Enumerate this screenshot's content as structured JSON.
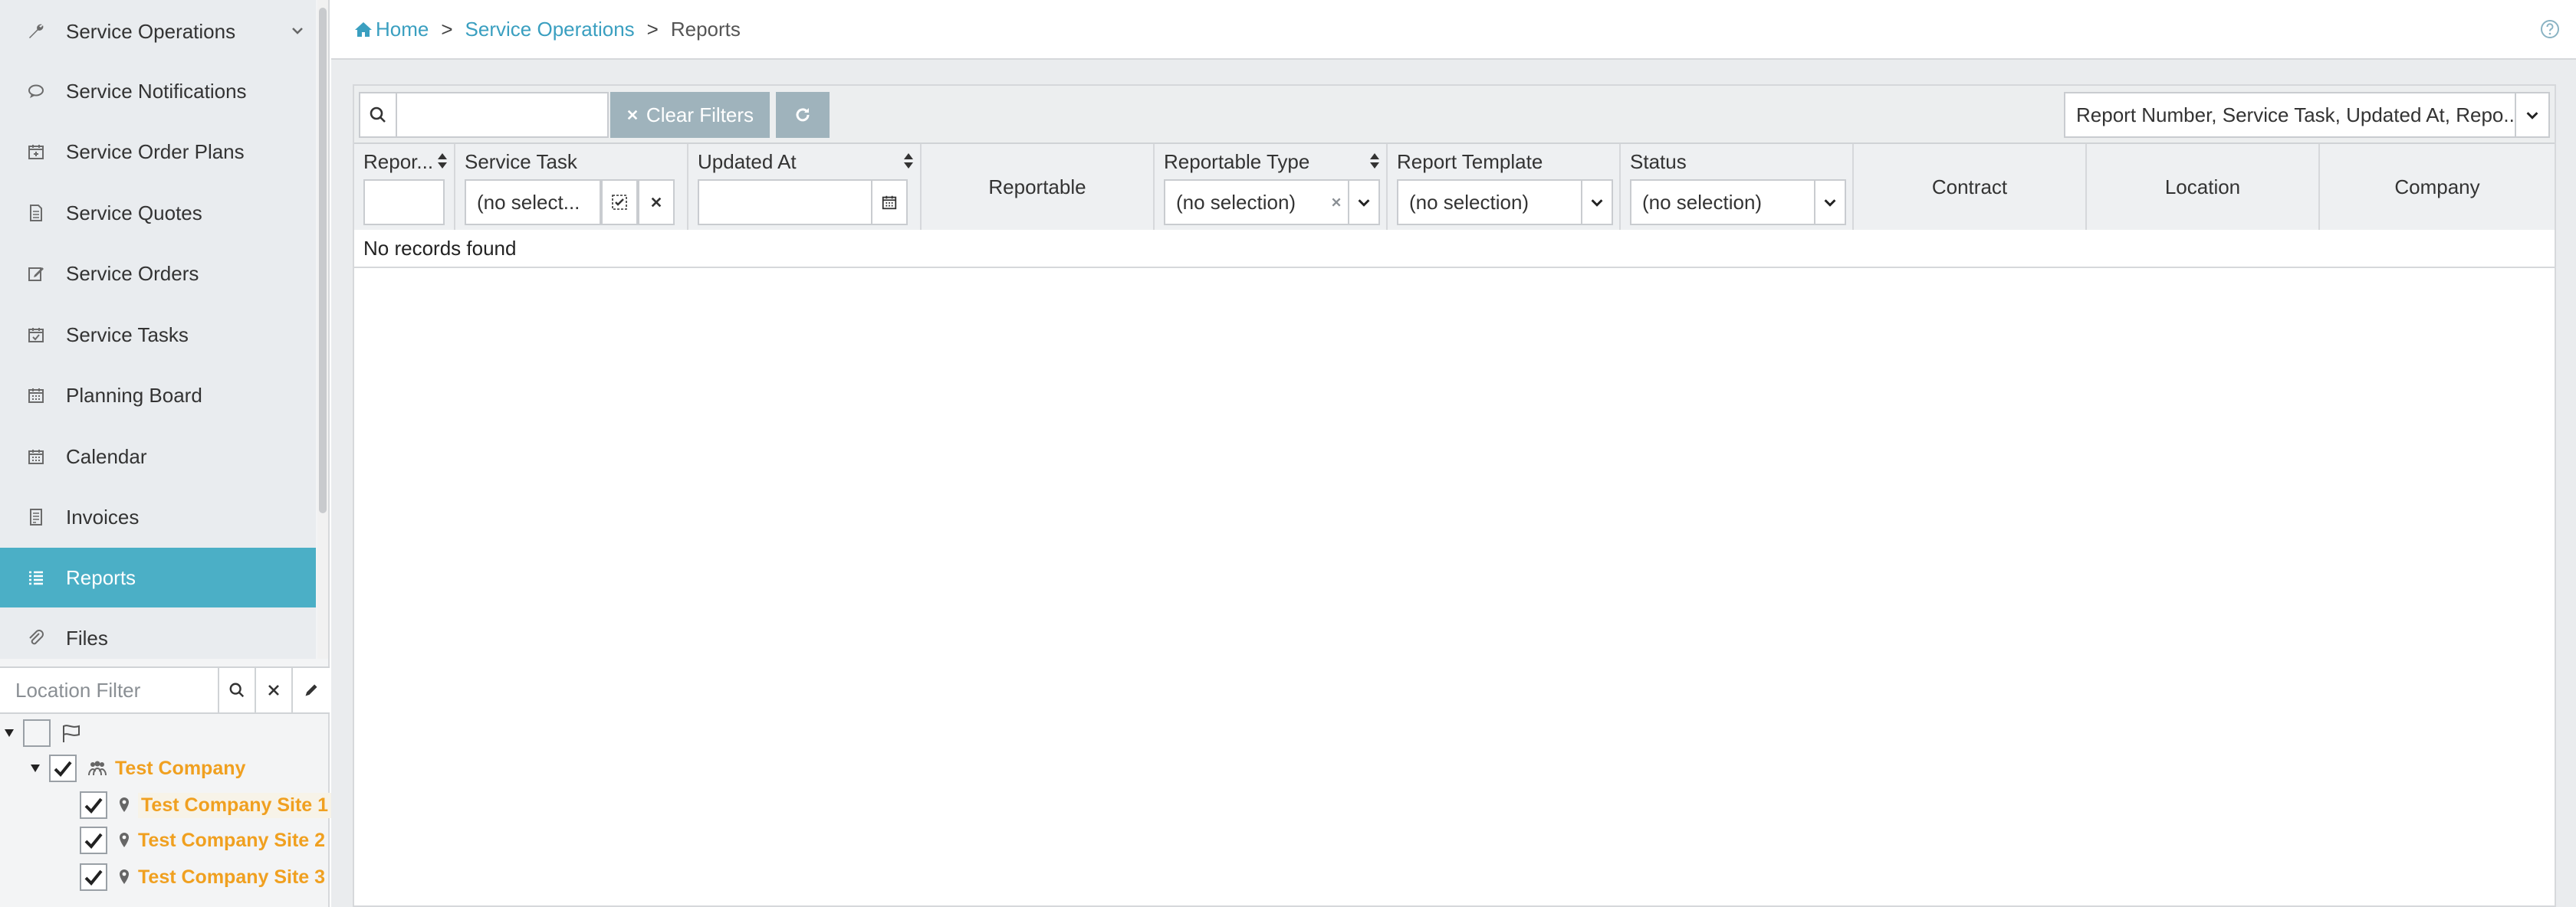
{
  "sidebar": {
    "items": [
      {
        "label": "Service Operations",
        "icon": "wrench-icon",
        "expandable": true
      },
      {
        "label": "Service Notifications",
        "icon": "comment-icon"
      },
      {
        "label": "Service Order Plans",
        "icon": "calendar-plus-icon"
      },
      {
        "label": "Service Quotes",
        "icon": "document-icon"
      },
      {
        "label": "Service Orders",
        "icon": "edit-icon"
      },
      {
        "label": "Service Tasks",
        "icon": "calendar-check-icon"
      },
      {
        "label": "Planning Board",
        "icon": "calendar-icon"
      },
      {
        "label": "Calendar",
        "icon": "calendar-icon"
      },
      {
        "label": "Invoices",
        "icon": "invoice-icon"
      },
      {
        "label": "Reports",
        "icon": "list-icon",
        "active": true
      },
      {
        "label": "Files",
        "icon": "paperclip-icon"
      }
    ],
    "location_filter": {
      "placeholder": "Location Filter"
    },
    "tree": {
      "company": "Test Company",
      "sites": [
        "Test Company Site 1",
        "Test Company Site 2",
        "Test Company Site 3"
      ]
    }
  },
  "breadcrumb": {
    "home": "Home",
    "section": "Service Operations",
    "current": "Reports",
    "separator": ">"
  },
  "toolbar": {
    "search_value": "",
    "clear_filters_label": "Clear Filters",
    "columns_value": "Report Number, Service Task, Updated At, Repo..."
  },
  "table": {
    "columns": [
      {
        "label": "Repor...",
        "sortable": true
      },
      {
        "label": "Service Task"
      },
      {
        "label": "Updated At",
        "sortable": true
      },
      {
        "label": "Reportable"
      },
      {
        "label": "Reportable Type",
        "sortable": true
      },
      {
        "label": "Report Template"
      },
      {
        "label": "Status"
      },
      {
        "label": "Contract"
      },
      {
        "label": "Location"
      },
      {
        "label": "Company"
      }
    ],
    "filters": {
      "service_task": "(no select...",
      "reportable_type": "(no selection)",
      "report_template": "(no selection)",
      "status": "(no selection)"
    },
    "empty_message": "No records found"
  },
  "colors": {
    "accent": "#4bafc6",
    "link": "#3a9fc0",
    "tree_label": "#f0a020",
    "button_muted": "#9fb3bc"
  }
}
